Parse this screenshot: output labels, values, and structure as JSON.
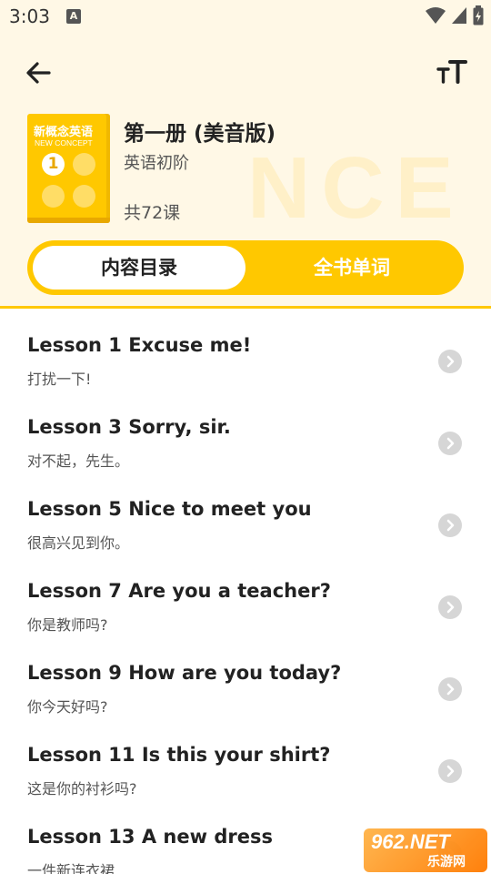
{
  "status_bar": {
    "time": "3:03",
    "notification_letter": "A"
  },
  "toolbar": {
    "back_icon": "arrow-left-icon",
    "font_size_label": "тT"
  },
  "book": {
    "cover_title": "新概念英语",
    "cover_subtitle": "NEW CONCEPT",
    "cover_number": "1",
    "title": "第一册 (美音版)",
    "level": "英语初阶",
    "count": "共72课",
    "watermark": "NCE"
  },
  "tabs": [
    {
      "label": "内容目录",
      "active": true
    },
    {
      "label": "全书单词",
      "active": false
    }
  ],
  "lessons": [
    {
      "title": "Lesson 1 Excuse me!",
      "subtitle": "打扰一下!"
    },
    {
      "title": "Lesson 3 Sorry, sir.",
      "subtitle": "对不起，先生。"
    },
    {
      "title": "Lesson 5 Nice to meet you",
      "subtitle": "很高兴见到你。"
    },
    {
      "title": "Lesson 7 Are you a teacher?",
      "subtitle": "你是教师吗?"
    },
    {
      "title": "Lesson 9 How are you today?",
      "subtitle": "你今天好吗?"
    },
    {
      "title": "Lesson 11 Is this your shirt?",
      "subtitle": "这是你的衬衫吗?"
    },
    {
      "title": "Lesson 13 A new dress",
      "subtitle": "一件新连衣裙"
    }
  ],
  "corner_logo": {
    "main": "962.NET",
    "sub": "乐游网"
  },
  "colors": {
    "accent": "#ffc800",
    "header_bg": "#fff8e6"
  }
}
